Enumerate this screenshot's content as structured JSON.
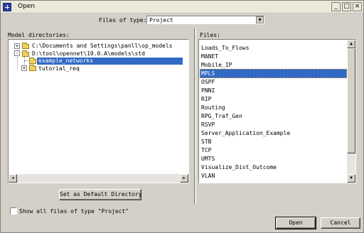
{
  "window": {
    "title": "Open",
    "controls": {
      "minimize": "_",
      "maximize": "□",
      "close": "×"
    }
  },
  "files_of_type": {
    "label": "Files of type:",
    "value": "Project",
    "arrow": "▼"
  },
  "model_directories": {
    "label": "Model directories:",
    "tree": [
      {
        "label": "C:\\Documents and Settings\\panll\\op_models",
        "toggle": "+"
      },
      {
        "label": "D:\\tool\\opennet\\10.0.A\\models\\std",
        "toggle": "-"
      },
      {
        "label": "example_networks",
        "selected": true
      },
      {
        "label": "tutorial_req",
        "toggle": "+"
      }
    ],
    "scroll_left": "◄",
    "scroll_right": "►"
  },
  "files": {
    "label": "Files:",
    "items": [
      "Loads_To_Flows",
      "MANET",
      "Mobile_IP",
      "MPLS",
      "OSPF",
      "PNNI",
      "RIP",
      "Routing",
      "RPG_Traf_Gen",
      "RSVP",
      "Server_Application_Example",
      "STB",
      "TCP",
      "UMTS",
      "Visualize_Dist_Outcome",
      "VLAN"
    ],
    "selected_item": "MPLS",
    "scroll_up": "▲",
    "scroll_down": "▼"
  },
  "buttons": {
    "default_dir": "Set as Default Directory",
    "open": "Open",
    "cancel": "Cancel"
  },
  "show_all": {
    "label": "Show all files of type \"Project\"",
    "checked": false
  },
  "colors": {
    "selection": "#316ac5",
    "face": "#d4d0c8",
    "folder": "#f0d060"
  }
}
